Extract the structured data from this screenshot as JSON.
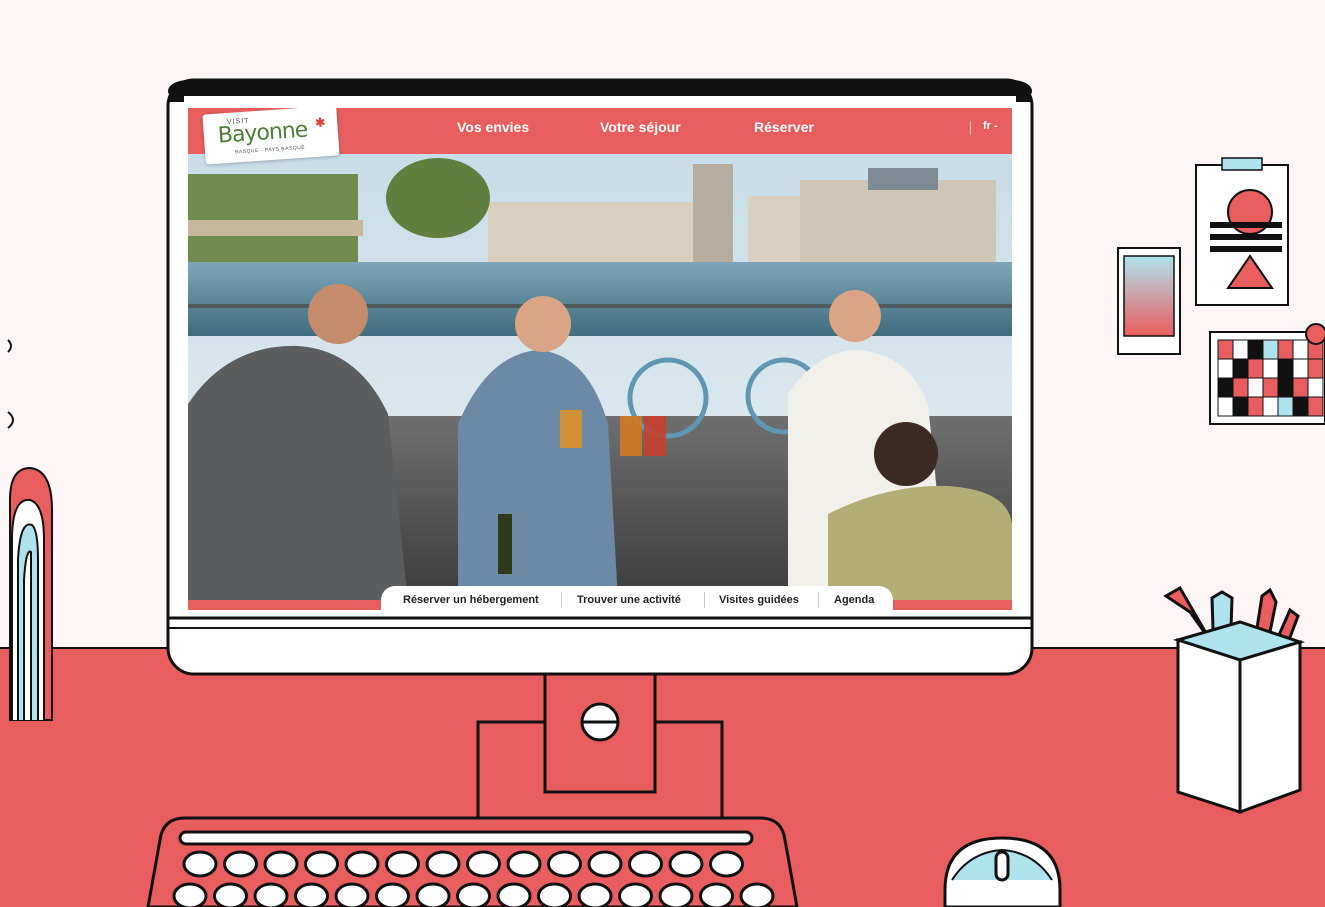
{
  "website": {
    "logo": {
      "visit": "VISIT",
      "name": "Bayonne",
      "sub": "BASQUE · PAYS BASQUE"
    },
    "nav": [
      {
        "label": "Vos envies"
      },
      {
        "label": "Votre séjour"
      },
      {
        "label": "Réserver"
      }
    ],
    "language": "fr -",
    "quick_links": [
      {
        "label": "Réserver un hébergement"
      },
      {
        "label": "Trouver une activité"
      },
      {
        "label": "Visites guidées"
      },
      {
        "label": "Agenda"
      }
    ]
  },
  "colors": {
    "brand_red": "#e85d5d",
    "desk": "#e85d5d",
    "background": "#fdf5f6",
    "logo_green": "#4d7d3a",
    "outline": "#111111",
    "accent_blue": "#aee3ee"
  },
  "icons": {
    "monitor": "monitor-icon",
    "keyboard": "keyboard-icon",
    "mouse": "mouse-icon",
    "pencil_cup": "pencil-cup-icon",
    "poster": "poster-icon",
    "photo_card": "photo-card-icon",
    "pixel_card": "pixel-card-icon",
    "arch": "arch-decoration-icon"
  }
}
